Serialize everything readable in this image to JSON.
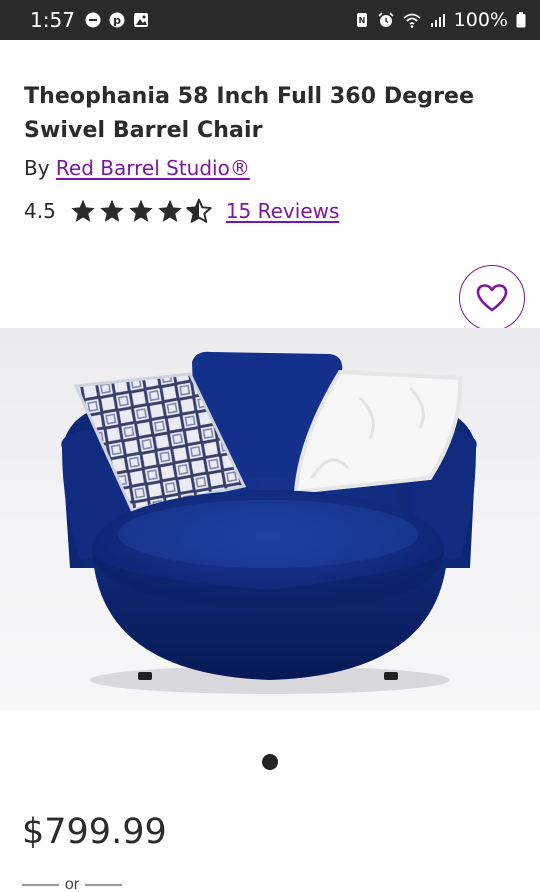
{
  "status_bar": {
    "time": "1:57",
    "battery": "100%",
    "left_icons": [
      "minus-circle-icon",
      "pinterest-icon",
      "image-icon"
    ],
    "right_icons": [
      "nfc-icon",
      "alarm-icon",
      "wifi-icon",
      "signal-icon",
      "battery-icon"
    ]
  },
  "product": {
    "title": "Theophania 58 Inch Full 360 Degree Swivel Barrel Chair",
    "by_prefix": "By",
    "brand": "Red Barrel Studio®",
    "rating_value": "4.5",
    "rating": 4.5,
    "reviews_label": "15 Reviews",
    "price": "$799.99",
    "or_text": "or"
  },
  "carousel": {
    "current": 1,
    "total": 1
  },
  "colors": {
    "accent": "#7b189f",
    "text": "#2b2b2b",
    "status_bar": "#2a2a2a",
    "chair": "#0f2a78"
  }
}
